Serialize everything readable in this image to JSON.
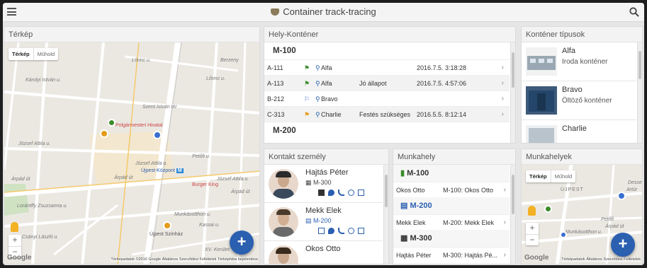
{
  "header": {
    "title": "Container track-tracing"
  },
  "terkep": {
    "title": "Térkép",
    "toggle": {
      "map": "Térkép",
      "satellite": "Műhold"
    },
    "google": "Google",
    "footer": "Térképadatok ©2016 Google   Általános Szerződési Feltételek   Térképhiba bejelentése",
    "labels": {
      "lorinc1": "Lőrinc u.",
      "lorinc2": "Lőrinc u.",
      "berzeny": "Berzeny",
      "karolyi": "Károlyi István u.",
      "szentistvan": "Szent István tér",
      "polgarmesteri": "Polgármesteri Hivatal",
      "jozsef1": "József Attila u.",
      "jozsef2": "József Attila u.",
      "jozsef3": "József Attila u.",
      "petofi": "Petőfi u.",
      "arpad1": "Árpád út",
      "arpad2": "Árpád út",
      "arpad3": "Árpád út",
      "ujpest_kozpont": "Újpest-Központ",
      "burger": "Burger King",
      "lorantffy": "Lorántffy Zsuzsanna u.",
      "munkasotthon": "Munkásotthon u.",
      "szinhaz": "Újpest Színház",
      "csanyi": "Csányi László u.",
      "xv_kerulet": "XV. Kerület",
      "kassai": "Kassai u."
    }
  },
  "hely_kontener": {
    "title": "Hely-Konténer",
    "groups": [
      {
        "name": "M-100",
        "rows": [
          {
            "code": "A-111",
            "type": "Alfa",
            "status": "",
            "date": "2016.7.5. 3:18:28",
            "flag": "#3a8c2a"
          },
          {
            "code": "A-113",
            "type": "Alfa",
            "status": "Jó állapot",
            "date": "2016.7.5. 4:57:06",
            "flag": "#3a8c2a"
          },
          {
            "code": "B-212",
            "type": "Bravo",
            "status": "",
            "date": "",
            "flag": "#3a6fd0"
          },
          {
            "code": "C-313",
            "type": "Charlie",
            "status": "Festés szükséges",
            "date": "2016.5.5. 8:12:14",
            "flag": "#e39b1a"
          }
        ]
      },
      {
        "name": "M-200",
        "rows": []
      }
    ]
  },
  "kontener_tipusok": {
    "title": "Konténer típusok",
    "items": [
      {
        "name": "Alfa",
        "desc": "Iroda konténer"
      },
      {
        "name": "Bravo",
        "desc": "Öltöző konténer"
      },
      {
        "name": "Charlie",
        "desc": ""
      }
    ]
  },
  "kontakt": {
    "title": "Kontakt személy",
    "people": [
      {
        "name": "Hajtás Péter",
        "loc": "M-300"
      },
      {
        "name": "Mekk Elek",
        "loc": "M-200"
      },
      {
        "name": "Okos Otto",
        "loc": ""
      }
    ]
  },
  "munkahely": {
    "title": "Munkahely",
    "groups": [
      {
        "name": "M-100",
        "rows": [
          {
            "person": "Okos Otto",
            "value": "M-100: Okos Otto"
          }
        ]
      },
      {
        "name": "M-200",
        "rows": [
          {
            "person": "Mekk Elek",
            "value": "M-200: Mekk Elek"
          }
        ]
      },
      {
        "name": "M-300",
        "rows": [
          {
            "person": "Hajtás Péter",
            "value": "M-300: Hajtás Pé..."
          }
        ]
      }
    ]
  },
  "munkahelyek": {
    "title": "Munkahelyek",
    "toggle": {
      "map": "Térkép",
      "satellite": "Műhold"
    },
    "google": "Google",
    "footer": "Térképadatok   Általános Szerződési Feltételek",
    "labels": {
      "ujpest": "ÚJPEST",
      "munkasotthon": "Munkásotthon u.",
      "arpad": "Árpád út",
      "petofi": "Petőfi",
      "desse": "Desse",
      "artur": "Artúr"
    }
  },
  "colors": {
    "accent": "#2b5fb0",
    "green": "#3a8c2a",
    "orange": "#e39b1a",
    "blue": "#3a6fd0"
  }
}
